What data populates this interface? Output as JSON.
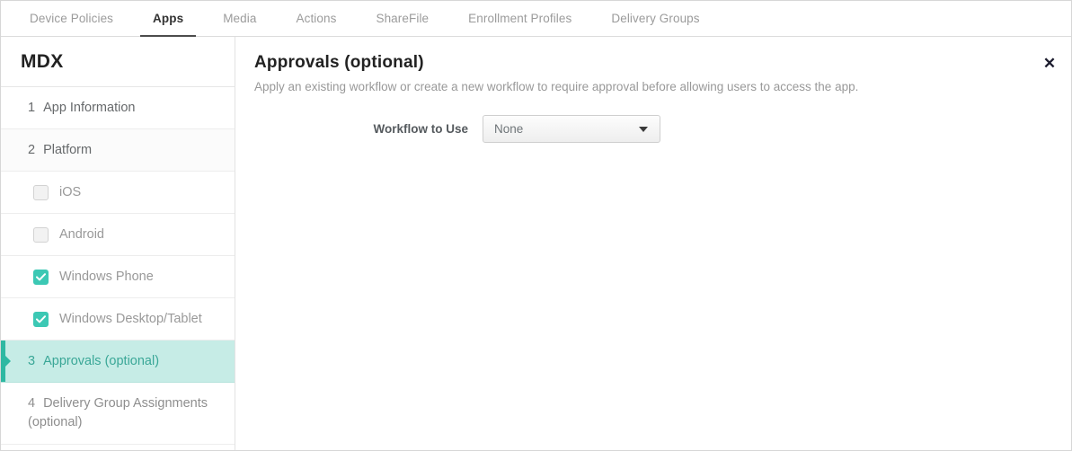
{
  "tabs": [
    {
      "label": "Device Policies",
      "active": false
    },
    {
      "label": "Apps",
      "active": true
    },
    {
      "label": "Media",
      "active": false
    },
    {
      "label": "Actions",
      "active": false
    },
    {
      "label": "ShareFile",
      "active": false
    },
    {
      "label": "Enrollment Profiles",
      "active": false
    },
    {
      "label": "Delivery Groups",
      "active": false
    }
  ],
  "sidebar": {
    "title": "MDX",
    "items": [
      {
        "num": "1",
        "label": "App Information"
      },
      {
        "num": "2",
        "label": "Platform"
      },
      {
        "label": "iOS",
        "checked": false
      },
      {
        "label": "Android",
        "checked": false
      },
      {
        "label": "Windows Phone",
        "checked": true
      },
      {
        "label": "Windows Desktop/Tablet",
        "checked": true
      },
      {
        "num": "3",
        "label": "Approvals (optional)",
        "selected": true
      },
      {
        "num": "4",
        "label": "Delivery Group Assignments (optional)"
      }
    ]
  },
  "panel": {
    "title": "Approvals (optional)",
    "description": "Apply an existing workflow or create a new workflow to require approval before allowing users to access the app.",
    "form": {
      "workflow_label": "Workflow to Use",
      "workflow_value": "None",
      "workflow_options": [
        "None"
      ]
    },
    "close_icon": "✕"
  },
  "colors": {
    "accent_teal": "#3cc8b4",
    "selected_bg": "#c6ece6",
    "selected_text": "#3aa797",
    "accent_bar": "#2fb8a2"
  }
}
